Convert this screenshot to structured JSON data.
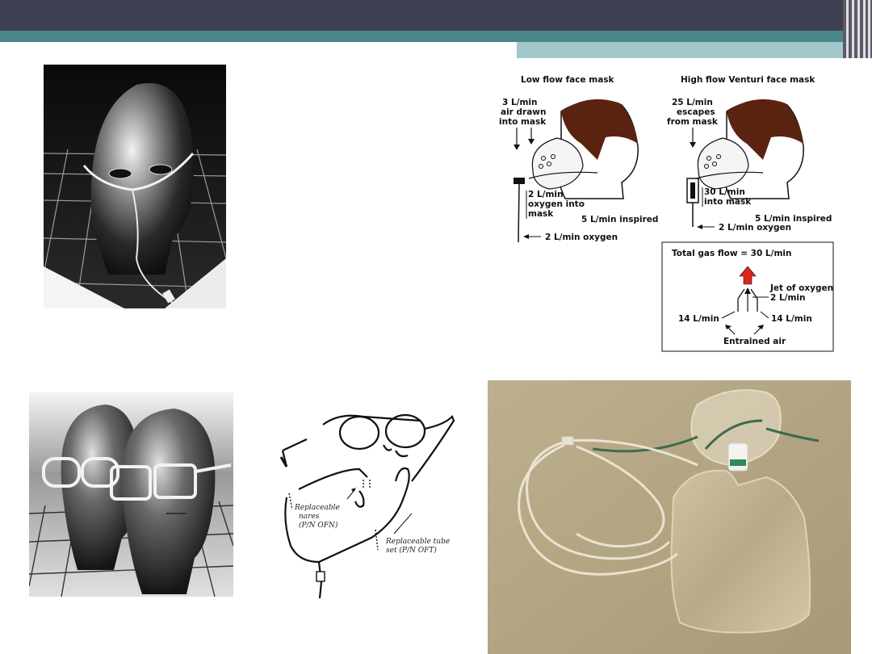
{
  "diagram": {
    "low_title": "Low flow face mask",
    "high_title": "High flow Venturi face mask",
    "low_air_1": "3 L/min",
    "low_air_2": "air drawn",
    "low_air_3": "into mask",
    "low_o2_1": "2 L/min",
    "low_o2_2": "oxygen into",
    "low_o2_3": "mask",
    "low_inspired": "5 L/min inspired",
    "low_oxygen": "2 L/min oxygen",
    "high_esc_1": "25 L/min",
    "high_esc_2": "escapes",
    "high_esc_3": "from mask",
    "high_into_1": "30 L/min",
    "high_into_2": "into mask",
    "high_inspired": "5 L/min inspired",
    "high_oxygen": "2 L/min oxygen",
    "box_total": "Total gas flow =  30 L/min",
    "box_jet_1": "Jet of oxygen",
    "box_jet_2": "2 L/min",
    "box_left": "14 L/min",
    "box_right": "14 L/min",
    "box_entrained": "Entrained air"
  },
  "cannula_labels": {
    "nares_1": "Replaceable",
    "nares_2": "nares",
    "nares_3": "(P/N OFN)",
    "tube_1": "Replaceable tube",
    "tube_2": "set (P/N OFT)"
  },
  "colors": {
    "topbar": "#3f3f52",
    "teal": "#4a8588",
    "light_teal": "#a3c8cb",
    "arrow_red": "#e0261c"
  }
}
